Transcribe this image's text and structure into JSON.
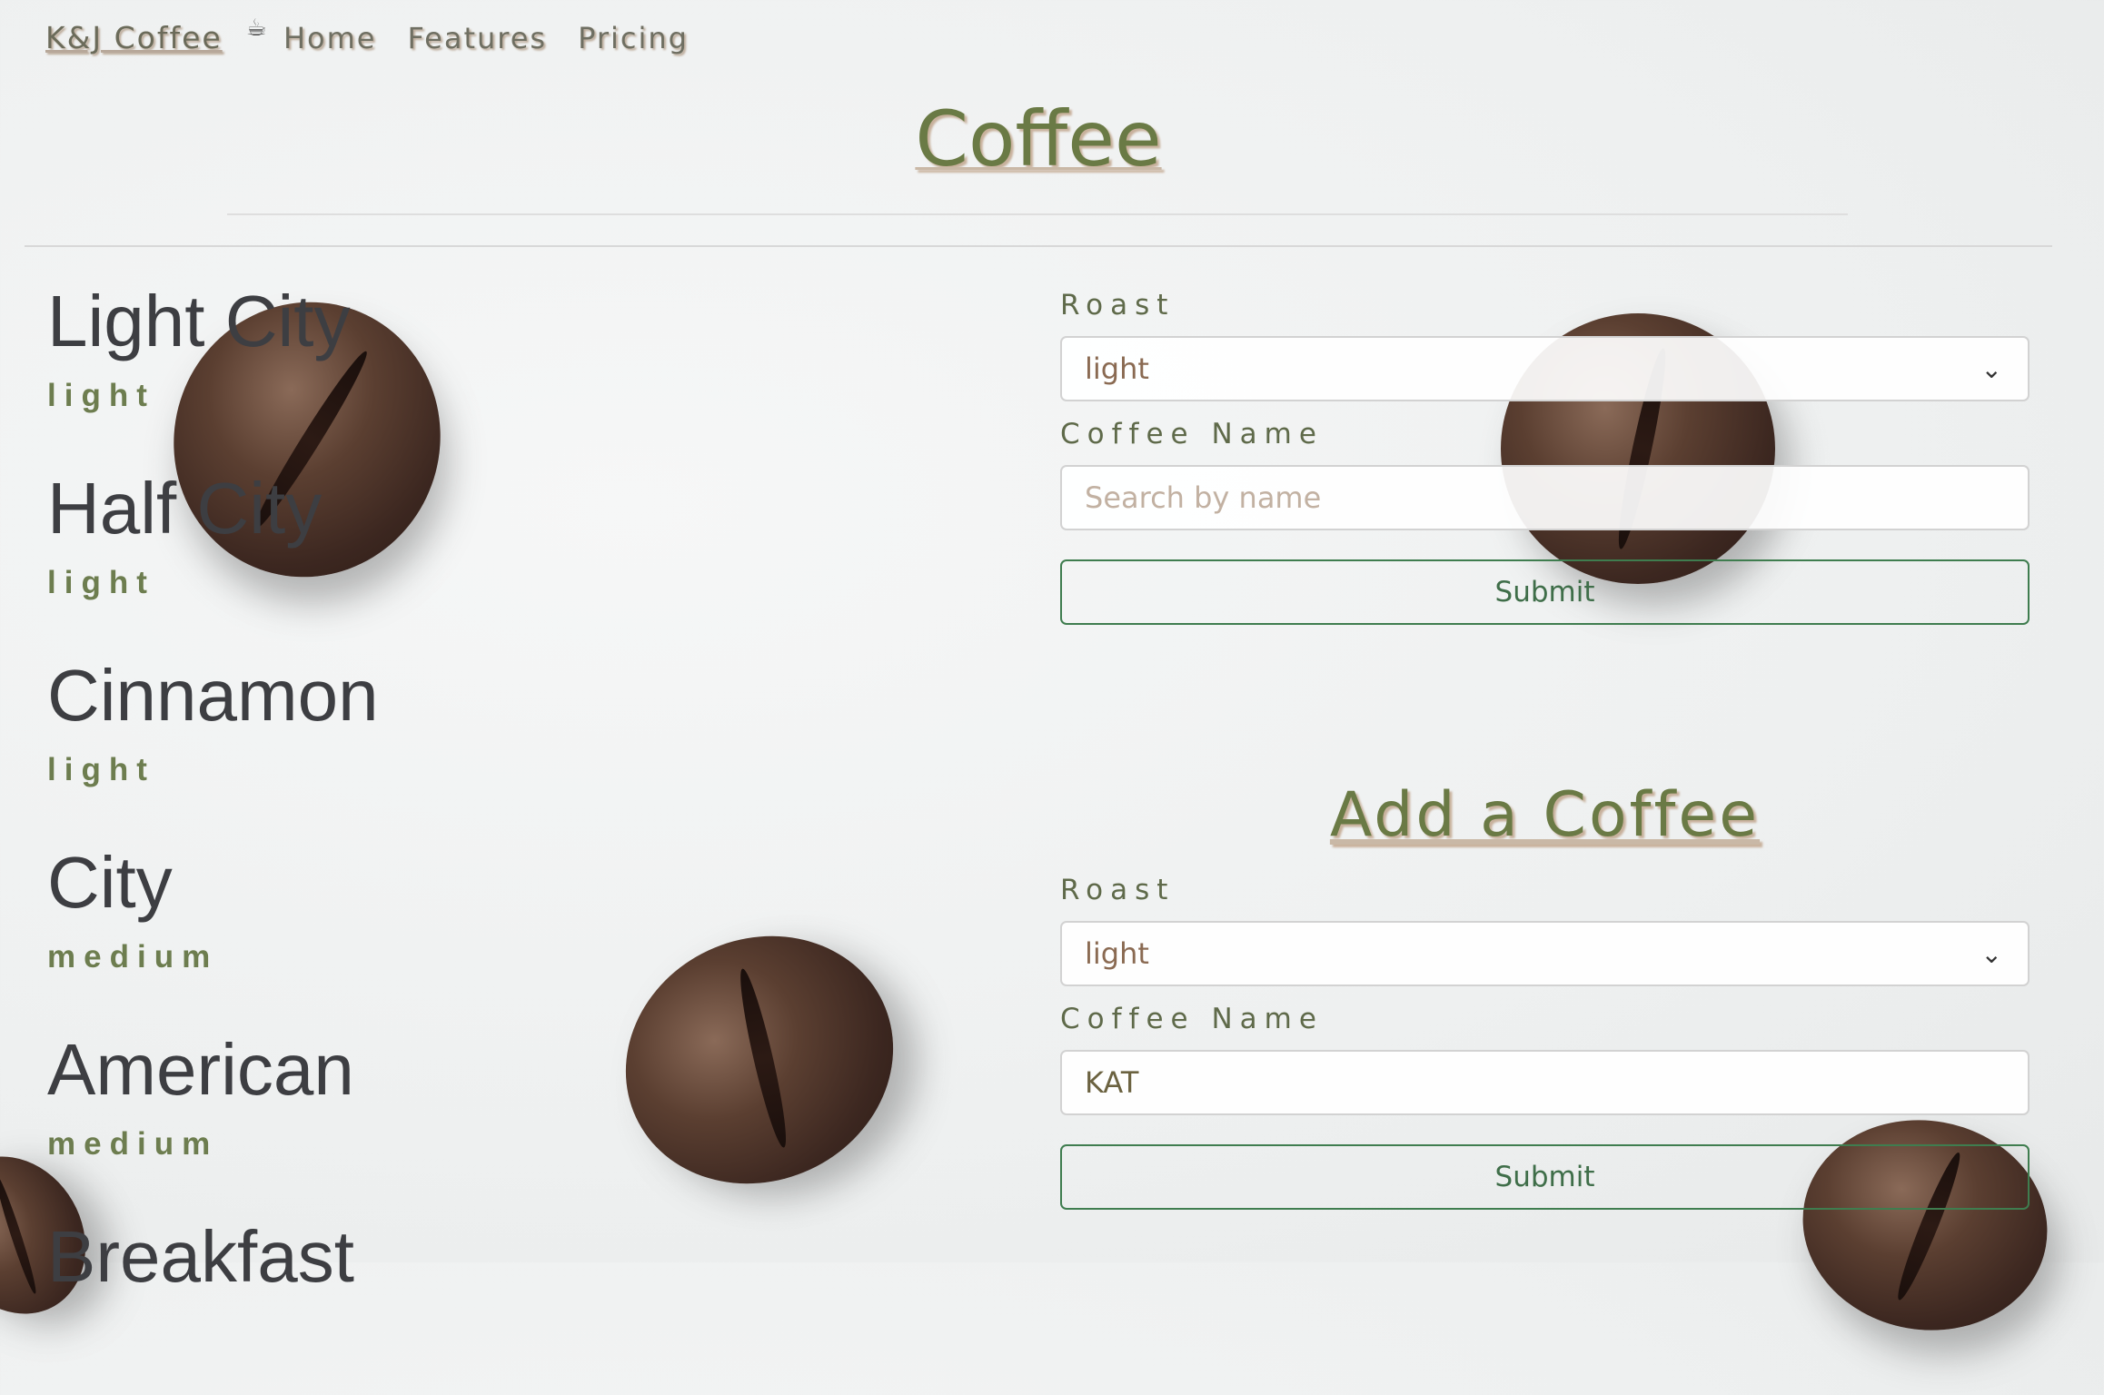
{
  "nav": {
    "brand": "K&J Coffee",
    "links": [
      "Home",
      "Features",
      "Pricing"
    ]
  },
  "page_title": "Coffee",
  "coffees": [
    {
      "name": "Light City",
      "roast": "light"
    },
    {
      "name": "Half City",
      "roast": "light"
    },
    {
      "name": "Cinnamon",
      "roast": "light"
    },
    {
      "name": "City",
      "roast": "medium"
    },
    {
      "name": "American",
      "roast": "medium"
    },
    {
      "name": "Breakfast",
      "roast": ""
    }
  ],
  "search_form": {
    "roast_label": "Roast",
    "roast_value": "light",
    "name_label": "Coffee Name",
    "name_placeholder": "Search by name",
    "submit_label": "Submit"
  },
  "add_form": {
    "title": "Add a Coffee",
    "roast_label": "Roast",
    "roast_value": "light",
    "name_label": "Coffee Name",
    "name_value": "KAT",
    "submit_label": "Submit"
  },
  "colors": {
    "accent_green": "#6a7a45",
    "button_border": "#3f7d4f"
  }
}
